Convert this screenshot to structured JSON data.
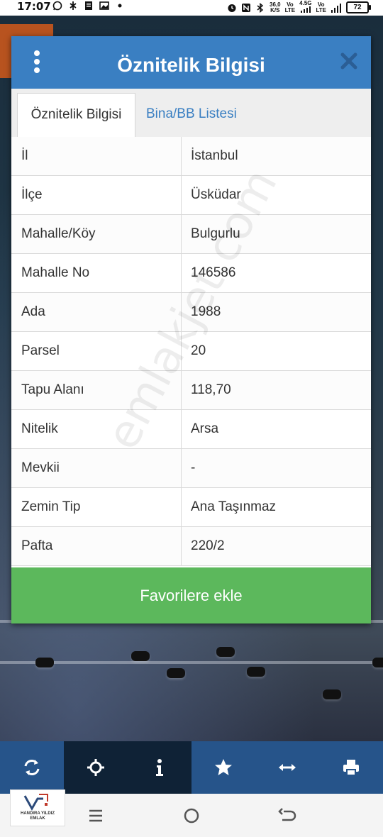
{
  "status_bar": {
    "time": "17:07",
    "speed_value": "36,0",
    "speed_unit": "K/S",
    "net1_top": "Vo",
    "net1_bottom": "LTE",
    "net_type": "4.5G",
    "net2_top": "Vo",
    "net2_bottom": "LTE",
    "battery": "72"
  },
  "dialog": {
    "title": "Öznitelik Bilgisi",
    "tabs": [
      {
        "label": "Öznitelik Bilgisi"
      },
      {
        "label": "Bina/BB Listesi"
      }
    ],
    "rows": [
      {
        "key": "İl",
        "value": "İstanbul"
      },
      {
        "key": "İlçe",
        "value": "Üsküdar"
      },
      {
        "key": "Mahalle/Köy",
        "value": "Bulgurlu"
      },
      {
        "key": "Mahalle No",
        "value": "146586"
      },
      {
        "key": "Ada",
        "value": "1988"
      },
      {
        "key": "Parsel",
        "value": "20"
      },
      {
        "key": "Tapu Alanı",
        "value": "118,70"
      },
      {
        "key": "Nitelik",
        "value": "Arsa"
      },
      {
        "key": "Mevkii",
        "value": "-"
      },
      {
        "key": "Zemin Tip",
        "value": "Ana Taşınmaz"
      },
      {
        "key": "Pafta",
        "value": "220/2"
      }
    ],
    "favorite_button": "Favorilere ekle"
  },
  "watermark": "emlakjet.com",
  "toolbar": {
    "items": [
      "refresh-icon",
      "locate-icon",
      "info-icon",
      "star-icon",
      "measure-icon",
      "print-icon"
    ],
    "active_index": 2
  },
  "logo": {
    "line1": "HANDIRA YILDIZ",
    "line2": "EMLAK"
  },
  "colors": {
    "header": "#3a7fc2",
    "favorite": "#5cb85c",
    "toolbar": "#26548a",
    "toolbar_active": "#0f2236"
  }
}
